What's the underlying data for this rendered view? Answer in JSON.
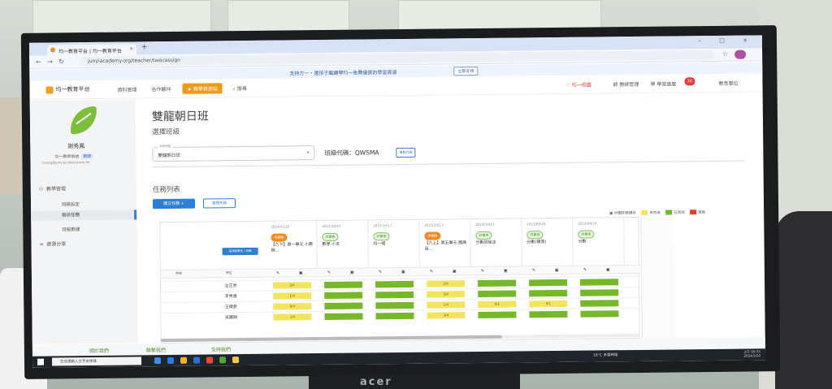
{
  "browser": {
    "tab_title": "均一教育平台 | 均一教育平台",
    "new_tab": "+",
    "window_controls": "– □ ×",
    "url": "junyiacademy.org/teacher/task/assign",
    "notice_text": "支持方一・選孩子繼續學均一免費優質的學習資源",
    "notice_button": "立即支持"
  },
  "header": {
    "logo_text": "均一教育平台",
    "nav": [
      "資料管理",
      "合作夥伴"
    ],
    "active_nav": "★ 教學資源站",
    "search_label": "搜尋",
    "right_items": [
      "♡ 均一校園",
      "師 教師管理",
      "學 學習進度"
    ],
    "badge_count": "20",
    "user_label": "教育單位"
  },
  "sidebar": {
    "user_name": "謝秀鳳",
    "user_role": "均一教師帳號",
    "role_tag": "教師",
    "user_email": "huang@junyiacademy.edu.tw",
    "section_label": "教學管理",
    "items": [
      "班級設定",
      "指派任務",
      "班級數據"
    ],
    "share_label": "資源分享"
  },
  "main": {
    "page_title": "雙龍朝日班",
    "choose_class_label": "選擇班級",
    "class_select_legend": "目前班級",
    "class_select_value": "雙龍朝日班",
    "class_code": "班級代碼：QWSMA",
    "copy_button": "複製代碼",
    "task_list_label": "任務列表",
    "add_task_button": "建立任務 +",
    "manage_button": "管理任務",
    "legend": [
      "分類任務標示",
      "未完成",
      "已完成",
      "落後"
    ]
  },
  "grid": {
    "assign_button": "指派給學生 / 班級",
    "header_labels": [
      "序號",
      "學生"
    ],
    "columns": [
      {
        "date": "2024/01/26",
        "tag": "未開始",
        "tag_style": "orange",
        "name": "【六下】第一單元 小數除…"
      },
      {
        "date": "2023/10/14",
        "tag": "評量卷",
        "tag_style": "green",
        "name": "數學 小五"
      },
      {
        "date": "2023/10/17",
        "tag": "評量卷",
        "tag_style": "green",
        "name": "均一組"
      },
      {
        "date": "2023/10/17",
        "tag": "未開始",
        "tag_style": "orange",
        "name": "【六上】第五單元 圓周長…"
      },
      {
        "date": "2023/10/17",
        "tag": "評量卷",
        "tag_style": "green",
        "name": "分數的除法"
      },
      {
        "date": "2023/09/26",
        "tag": "評量卷",
        "tag_style": "green",
        "name": "分數(複習)"
      },
      {
        "date": "2023/09/25",
        "tag": "評量卷",
        "tag_style": "green",
        "name": "分數"
      }
    ],
    "students": [
      "全正亮",
      "李秀蓮",
      "王曉愛",
      "吳麗娟"
    ],
    "cells": [
      [
        "2/4",
        "",
        "",
        "2/4",
        "",
        "",
        ""
      ],
      [
        "1/4",
        "",
        "",
        "3/4",
        "",
        "",
        ""
      ],
      [
        "0/4",
        "",
        "",
        "1/4",
        "0/1",
        "0/1",
        ""
      ],
      [
        "1/4",
        "",
        "",
        "3/4",
        "",
        "",
        ""
      ]
    ],
    "cell_status": [
      [
        "partial",
        "done",
        "done",
        "partial",
        "done",
        "done",
        "done"
      ],
      [
        "partial",
        "done",
        "done",
        "partial",
        "done",
        "done",
        "done"
      ],
      [
        "partial",
        "done",
        "done",
        "partial",
        "partial",
        "partial",
        "done"
      ],
      [
        "partial",
        "done",
        "done",
        "partial",
        "done",
        "done",
        "done"
      ]
    ]
  },
  "footer": {
    "links": [
      "關於我們",
      "聯繫我們",
      "支持我們"
    ]
  },
  "taskbar": {
    "search_placeholder": "在這裡輸入文字來搜尋",
    "weather": "16°C 多雲時陰",
    "time": "上午 09:35",
    "date": "2024/3/20"
  },
  "colors": {
    "accent": "#2d7fd6",
    "done": "#76b82a",
    "partial": "#f2e45e",
    "late": "#e53935",
    "nav_active": "#f09a1a"
  },
  "monitor_brand": "acer"
}
